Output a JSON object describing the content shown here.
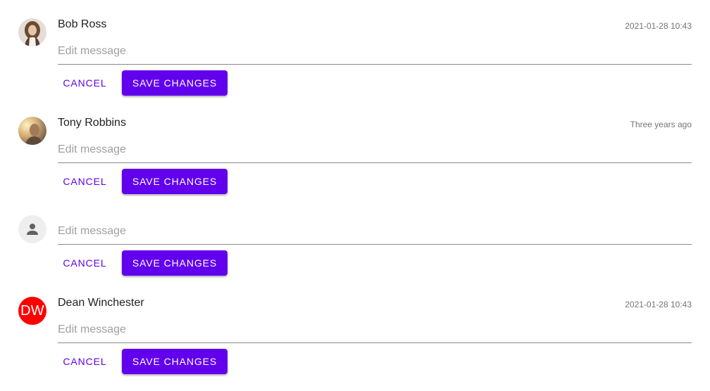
{
  "comments": [
    {
      "author": "Bob Ross",
      "timestamp": "2021-01-28 10:43",
      "avatar_type": "photo",
      "edit_placeholder": "Edit message",
      "cancel_label": "CANCEL",
      "save_label": "SAVE CHANGES"
    },
    {
      "author": "Tony Robbins",
      "timestamp": "Three years ago",
      "avatar_type": "photo",
      "edit_placeholder": "Edit message",
      "cancel_label": "CANCEL",
      "save_label": "SAVE CHANGES"
    },
    {
      "author": "",
      "timestamp": "",
      "avatar_type": "person-icon",
      "edit_placeholder": "Edit message",
      "cancel_label": "CANCEL",
      "save_label": "SAVE CHANGES"
    },
    {
      "author": "Dean Winchester",
      "timestamp": "2021-01-28 10:43",
      "avatar_type": "initials",
      "avatar_initials": "DW",
      "avatar_color": "#ff0000",
      "edit_placeholder": "Edit message",
      "cancel_label": "CANCEL",
      "save_label": "SAVE CHANGES"
    }
  ],
  "colors": {
    "primary": "#6200ee",
    "divider": "#8a8a8a",
    "placeholder_text": "#a0a0a0",
    "timestamp_text": "#757575",
    "placeholder_avatar_bg": "#eeeeee"
  }
}
